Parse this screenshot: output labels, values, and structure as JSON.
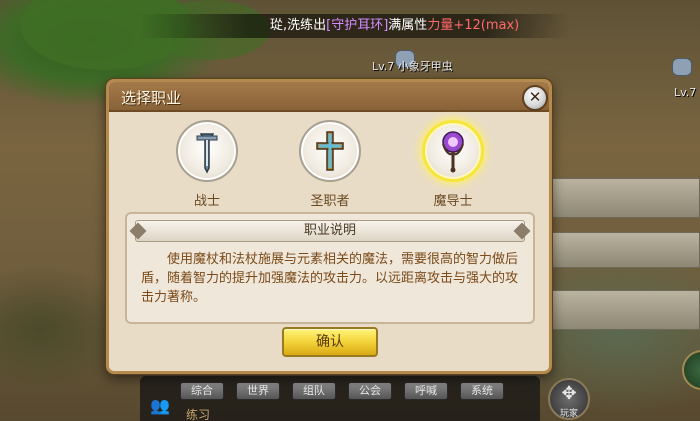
{
  "system_message": {
    "prefix": "㻜,洗练出",
    "item": "[守护耳环]",
    "middle": "满属性",
    "stat": "力量+12(max)"
  },
  "mobs": [
    {
      "label": "Lv.7  小象牙甲虫"
    },
    {
      "label": "Lv.7"
    }
  ],
  "dialog": {
    "title": "选择职业",
    "close_glyph": "✕",
    "classes": [
      {
        "name": "战士",
        "icon": "sword-icon",
        "selected": false
      },
      {
        "name": "圣职者",
        "icon": "cross-icon",
        "selected": false
      },
      {
        "name": "魔导士",
        "icon": "staff-icon",
        "selected": true
      }
    ],
    "description": {
      "header": "职业说明",
      "text": "使用魔杖和法杖施展与元素相关的魔法，需要很高的智力做后盾，随着智力的提升加强魔法的攻击力。以远距离攻击与强大的攻击力著称。"
    },
    "confirm_label": "确认"
  },
  "chat": {
    "tabs": [
      "综合",
      "世界",
      "组队",
      "公会",
      "呼喊",
      "系统"
    ],
    "input_text": "练习"
  },
  "corner_button": {
    "label": "玩家"
  },
  "colors": {
    "accent_gold": "#f3d23a",
    "dialog_bg": "#e9dcc6",
    "title_bar": "#8a6238",
    "item_purple": "#d58cff",
    "stat_red": "#ff6a6a"
  }
}
